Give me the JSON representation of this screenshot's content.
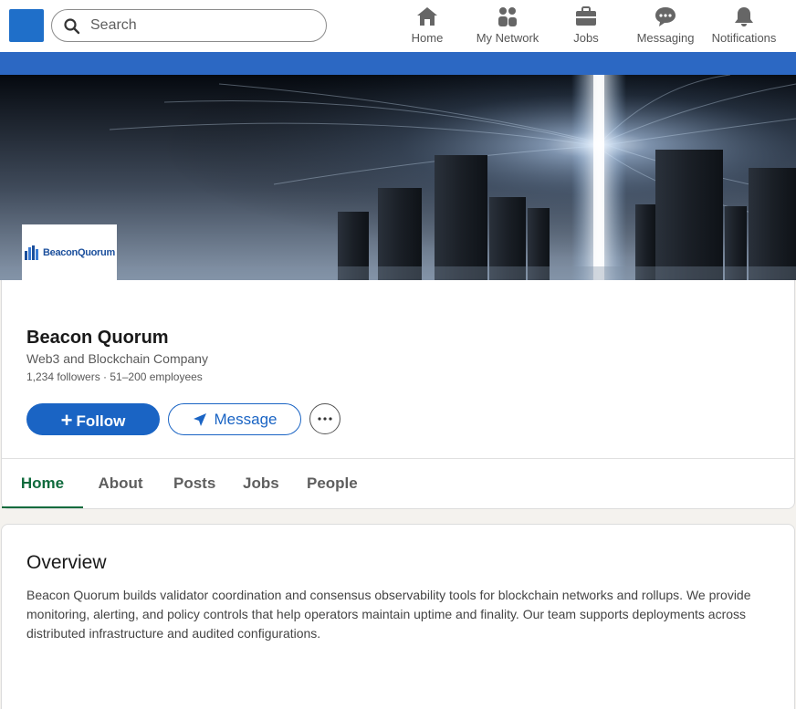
{
  "nav": {
    "search_placeholder": "Search",
    "items": [
      {
        "label": "Home",
        "icon": "home-icon"
      },
      {
        "label": "My Network",
        "icon": "people-icon"
      },
      {
        "label": "Jobs",
        "icon": "briefcase-icon"
      },
      {
        "label": "Messaging",
        "icon": "chat-icon"
      },
      {
        "label": "Notifications",
        "icon": "bell-icon"
      }
    ]
  },
  "company": {
    "logo_text": "BeaconQuorum",
    "name": "Beacon Quorum",
    "tagline": "Web3 and Blockchain Company",
    "meta": "1,234 followers · 51–200 employees"
  },
  "actions": {
    "follow_label": "Follow",
    "message_label": "Message",
    "more_label": "···"
  },
  "tabs": [
    {
      "label": "Home",
      "active": true
    },
    {
      "label": "About",
      "active": false
    },
    {
      "label": "Posts",
      "active": false
    },
    {
      "label": "Jobs",
      "active": false
    },
    {
      "label": "People",
      "active": false
    }
  ],
  "overview": {
    "title": "Overview",
    "text": "Beacon Quorum builds validator coordination and consensus observability tools for blockchain networks and rollups. We provide monitoring, alerting, and policy controls that help operators maintain uptime and finality. Our team supports deployments across distributed infrastructure and audited configurations."
  },
  "colors": {
    "brand_blue": "#1a64c4",
    "active_tab": "#106b3d",
    "blue_bar": "#2c68c3"
  }
}
